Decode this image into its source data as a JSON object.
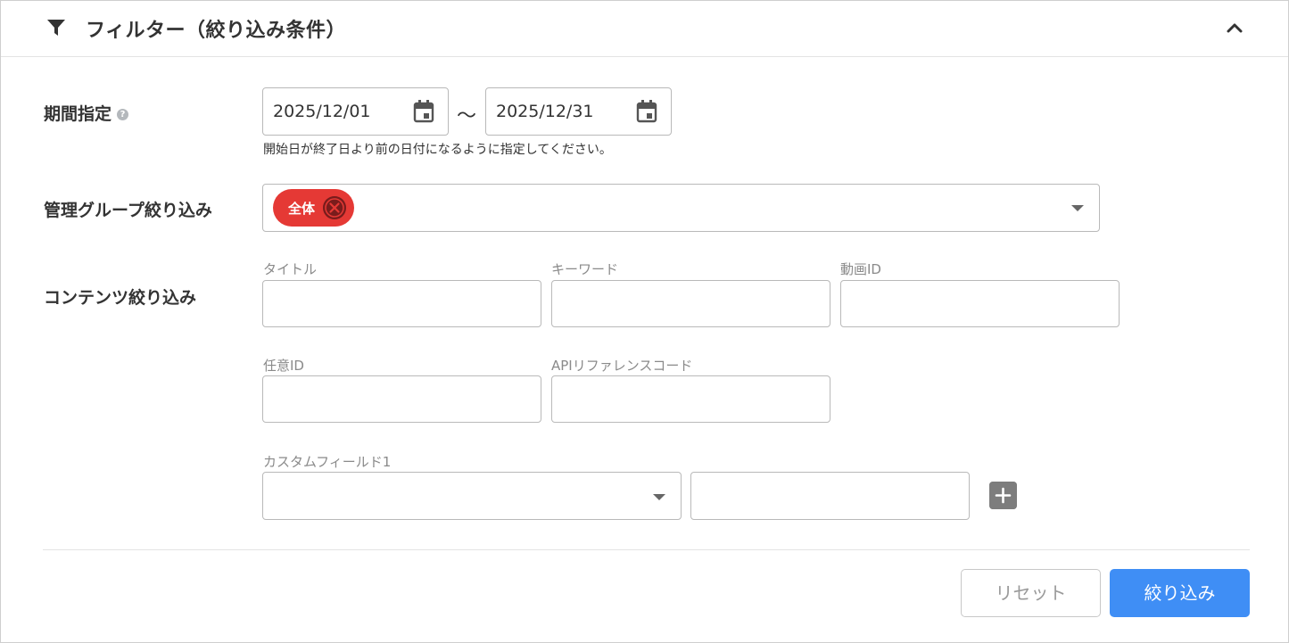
{
  "header": {
    "title": "フィルター（絞り込み条件）",
    "filter_icon": "filter-icon",
    "collapse_icon": "chevron-up-icon"
  },
  "period": {
    "label": "期間指定",
    "help_icon": "help-icon",
    "help_glyph": "?",
    "start_date": "2025/12/01",
    "end_date": "2025/12/31",
    "separator": "～",
    "hint": "開始日が終了日より前の日付になるように指定してください。",
    "calendar_icon": "calendar-icon"
  },
  "group_filter": {
    "label": "管理グループ絞り込み",
    "chips": [
      {
        "label": "全体",
        "color": "#e53935"
      }
    ],
    "dropdown_icon": "caret-down-icon"
  },
  "content_filter": {
    "label": "コンテンツ絞り込み",
    "fields": {
      "title": {
        "label": "タイトル",
        "value": ""
      },
      "keyword": {
        "label": "キーワード",
        "value": ""
      },
      "video_id": {
        "label": "動画ID",
        "value": ""
      },
      "custom_id": {
        "label": "任意ID",
        "value": ""
      },
      "api_ref": {
        "label": "APIリファレンスコード",
        "value": ""
      }
    },
    "custom_field": {
      "label": "カスタムフィールド1",
      "selected": "",
      "value": "",
      "add_icon": "plus-icon"
    }
  },
  "actions": {
    "reset_label": "リセット",
    "apply_label": "絞り込み",
    "apply_color": "#3f8ef5"
  }
}
